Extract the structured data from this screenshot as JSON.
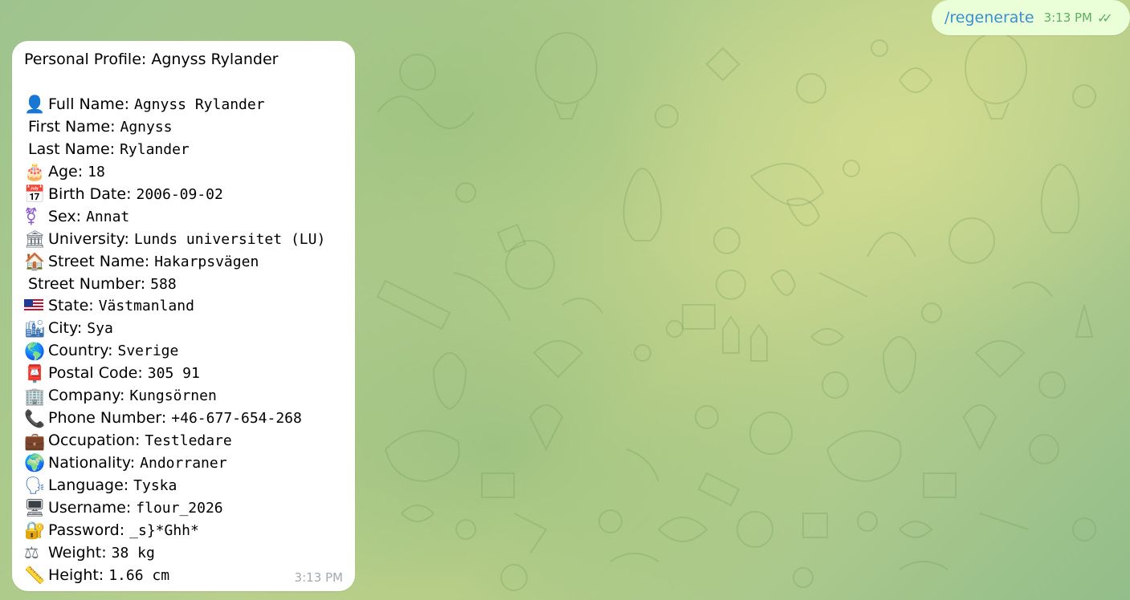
{
  "outgoing": {
    "command": "/regenerate",
    "time": "3:13 PM",
    "status_icon": "double-check-icon"
  },
  "profile_message": {
    "title": "Personal Profile: Agnyss Rylander",
    "time": "3:13 PM",
    "rows": [
      {
        "icon": "👤",
        "icon_name": "person-icon",
        "label": "Full Name:",
        "value": "Agnyss Rylander"
      },
      {
        "icon": "",
        "icon_name": "",
        "label": "First Name:",
        "value": "Agnyss"
      },
      {
        "icon": "",
        "icon_name": "",
        "label": "Last Name:",
        "value": "Rylander"
      },
      {
        "icon": "🎂",
        "icon_name": "birthday-cake-icon",
        "label": "Age:",
        "value": "18"
      },
      {
        "icon": "📅",
        "icon_name": "calendar-icon",
        "label": "Birth Date:",
        "value": "2006-09-02"
      },
      {
        "icon": "⚧",
        "icon_name": "transgender-symbol-icon",
        "label": "Sex:",
        "value": "Annat"
      },
      {
        "icon": "🏛",
        "icon_name": "classical-building-icon",
        "label": "University:",
        "value": "Lunds universitet (LU)"
      },
      {
        "icon": "🏠",
        "icon_name": "house-icon",
        "label": "Street Name:",
        "value": "Hakarpsvägen"
      },
      {
        "icon": "",
        "icon_name": "",
        "label": "Street Number:",
        "value": "588"
      },
      {
        "icon": "🇺🇸",
        "icon_name": "us-flag-icon",
        "label": "State:",
        "value": "Västmanland"
      },
      {
        "icon": "🏙",
        "icon_name": "cityscape-icon",
        "label": "City:",
        "value": "Sya"
      },
      {
        "icon": "🌎",
        "icon_name": "globe-americas-icon",
        "label": "Country:",
        "value": "Sverige"
      },
      {
        "icon": "📮",
        "icon_name": "postbox-icon",
        "label": "Postal Code:",
        "value": "305 91"
      },
      {
        "icon": "🏢",
        "icon_name": "office-building-icon",
        "label": "Company:",
        "value": "Kungsörnen"
      },
      {
        "icon": "📞",
        "icon_name": "telephone-receiver-icon",
        "label": "Phone Number:",
        "value": "+46-677-654-268"
      },
      {
        "icon": "💼",
        "icon_name": "briefcase-icon",
        "label": "Occupation:",
        "value": "Testledare"
      },
      {
        "icon": "🌍",
        "icon_name": "globe-europe-africa-icon",
        "label": "Nationality:",
        "value": "Andorraner"
      },
      {
        "icon": "🗣",
        "icon_name": "speaking-head-icon",
        "label": "Language:",
        "value": "Tyska"
      },
      {
        "icon": "🖥",
        "icon_name": "desktop-computer-icon",
        "label": "Username:",
        "value": "flour_2026"
      },
      {
        "icon": "🔐",
        "icon_name": "locked-with-key-icon",
        "label": "Password:",
        "value": "_s}*Ghh*"
      },
      {
        "icon": "⚖",
        "icon_name": "balance-scale-icon",
        "label": "Weight:",
        "value": "38 kg"
      },
      {
        "icon": "📏",
        "icon_name": "straight-ruler-icon",
        "label": "Height:",
        "value": "1.66 cm"
      }
    ]
  },
  "colors": {
    "outgoing_bubble": "#eaffd8",
    "incoming_bubble": "#ffffff",
    "link_blue": "#3a8fd0",
    "outgoing_meta": "#5fae63",
    "incoming_meta": "#a2a9b0"
  }
}
